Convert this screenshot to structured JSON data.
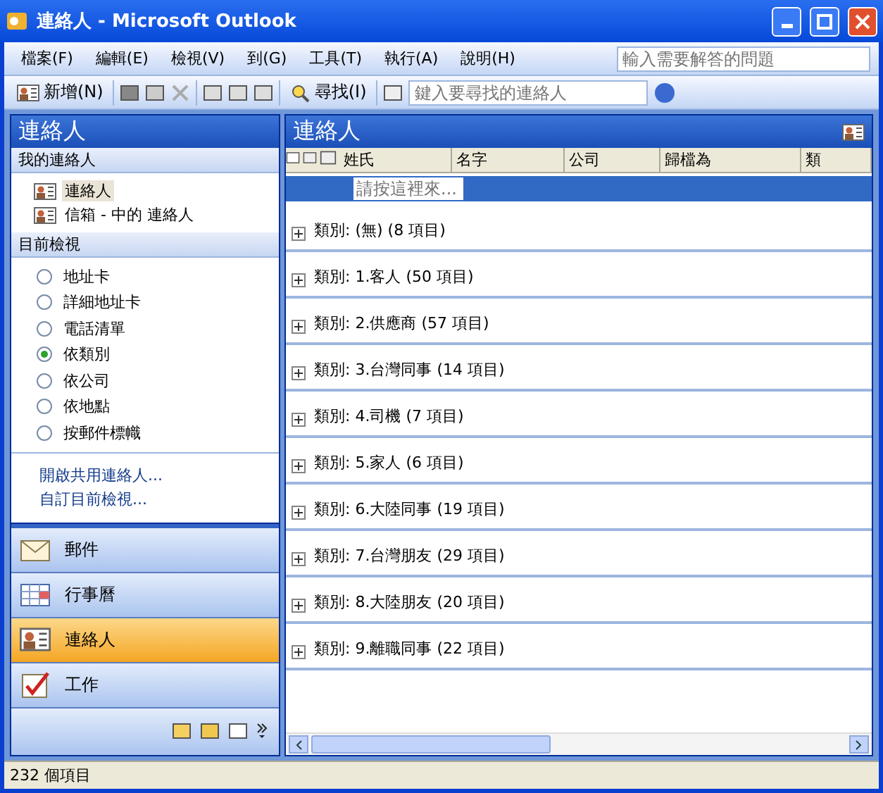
{
  "window": {
    "title": "連絡人 - Microsoft Outlook"
  },
  "menu": [
    "檔案(F)",
    "編輯(E)",
    "檢視(V)",
    "到(G)",
    "工具(T)",
    "執行(A)",
    "說明(H)"
  ],
  "help_search": {
    "placeholder": "輸入需要解答的問題"
  },
  "toolbar": {
    "new_label": "新增(N)",
    "find_label": "尋找(I)",
    "contact_search": {
      "placeholder": "鍵入要尋找的連絡人"
    }
  },
  "nav": {
    "title": "連絡人",
    "my_contacts": {
      "heading": "我的連絡人",
      "items": [
        {
          "label": "連絡人",
          "selected": true
        },
        {
          "label": "信箱 - 中的 連絡人",
          "selected": false
        }
      ]
    },
    "current_view": {
      "heading": "目前檢視",
      "options": [
        {
          "label": "地址卡",
          "selected": false
        },
        {
          "label": "詳細地址卡",
          "selected": false
        },
        {
          "label": "電話清單",
          "selected": false
        },
        {
          "label": "依類別",
          "selected": true
        },
        {
          "label": "依公司",
          "selected": false
        },
        {
          "label": "依地點",
          "selected": false
        },
        {
          "label": "按郵件標幟",
          "selected": false
        }
      ]
    },
    "links": [
      "開啟共用連絡人...",
      "自訂目前檢視..."
    ],
    "buttons": [
      {
        "label": "郵件",
        "kind": "mail",
        "selected": false
      },
      {
        "label": "行事曆",
        "kind": "calendar",
        "selected": false
      },
      {
        "label": "連絡人",
        "kind": "contacts",
        "selected": true
      },
      {
        "label": "工作",
        "kind": "tasks",
        "selected": false
      }
    ]
  },
  "list": {
    "title": "連絡人",
    "columns": [
      "姓氏",
      "名字",
      "公司",
      "歸檔為",
      "類"
    ],
    "new_item_placeholder": "請按這裡來...",
    "groups": [
      {
        "label": "類別: (無) (8 項目)",
        "expanded": false
      },
      {
        "label": "類別: 1.客人 (50 項目)",
        "expanded": false
      },
      {
        "label": "類別: 2.供應商 (57 項目)",
        "expanded": false
      },
      {
        "label": "類別: 3.台灣同事 (14 項目)",
        "expanded": false
      },
      {
        "label": "類別: 4.司機 (7 項目)",
        "expanded": false
      },
      {
        "label": "類別: 5.家人 (6 項目)",
        "expanded": false
      },
      {
        "label": "類別: 6.大陸同事 (19 項目)",
        "expanded": false
      },
      {
        "label": "類別: 7.台灣朋友 (29 項目)",
        "expanded": false
      },
      {
        "label": "類別: 8.大陸朋友 (20 項目)",
        "expanded": false
      },
      {
        "label": "類別: 9.離職同事 (22 項目)",
        "expanded": false
      }
    ]
  },
  "status_bar": {
    "text": "232 個項目"
  }
}
